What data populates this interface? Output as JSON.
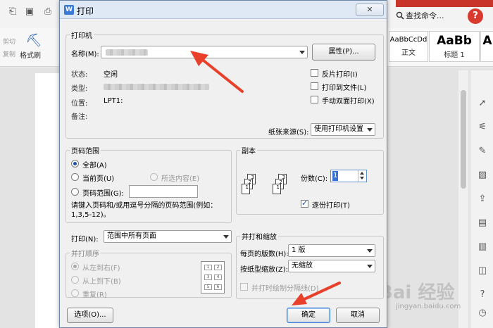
{
  "app": {
    "search_commands": "查找命令...",
    "help_badge": "?",
    "clipboard": {
      "cut": "剪切",
      "copy": "复制"
    },
    "format_painter": "格式刷",
    "styles": [
      {
        "sample": "AaBbCcDd",
        "name": "正文"
      },
      {
        "sample": "AaBb",
        "name": "标题 1"
      },
      {
        "sample": "A",
        "name": ""
      }
    ],
    "watermark": {
      "brand": "Bai 经验",
      "url": "jingyan.baidu.com"
    }
  },
  "dialog": {
    "title": "打印",
    "logo_letter": "W",
    "close_glyph": "✕",
    "printer": {
      "group_title": "打印机",
      "name_label": "名称(M):",
      "properties_button": "属性(P)...",
      "status_label": "状态:",
      "status_value": "空闲",
      "type_label": "类型:",
      "location_label": "位置:",
      "location_value": "LPT1:",
      "comment_label": "备注:",
      "reverse_print": "反片打印(I)",
      "print_to_file": "打印到文件(L)",
      "manual_duplex": "手动双面打印(X)",
      "paper_source_label": "纸张来源(S):",
      "paper_source_value": "使用打印机设置"
    },
    "page_range": {
      "group_title": "页码范围",
      "all": "全部(A)",
      "current_page": "当前页(U)",
      "selection": "所选内容(E)",
      "pages": "页码范围(G):",
      "hint": "请键入页码和/或用逗号分隔的页码范围(例如：1,3,5-12)。"
    },
    "copies": {
      "group_title": "副本",
      "count_label": "份数(C):",
      "count_value": "1",
      "collate": "逐份打印(T)"
    },
    "print_what": {
      "label": "打印(N):",
      "value": "范围中所有页面"
    },
    "order": {
      "group_title": "并打顺序",
      "left_to_right": "从左到右(F)",
      "top_to_bottom": "从上到下(B)",
      "repeat": "重复(R)",
      "preview_cells": [
        "1",
        "2",
        "3",
        "4",
        "5",
        "6"
      ]
    },
    "zoom": {
      "group_title": "并打和缩放",
      "pages_per_sheet_label": "每页的版数(H):",
      "pages_per_sheet_value": "1 版",
      "scale_label": "按纸型缩放(Z):",
      "scale_value": "无缩放",
      "draw_separator": "并打时绘制分隔线(D)"
    },
    "buttons": {
      "options": "选项(O)...",
      "ok": "确定",
      "cancel": "取消"
    }
  },
  "annotations": {
    "arrow_color": "#e8402a"
  }
}
